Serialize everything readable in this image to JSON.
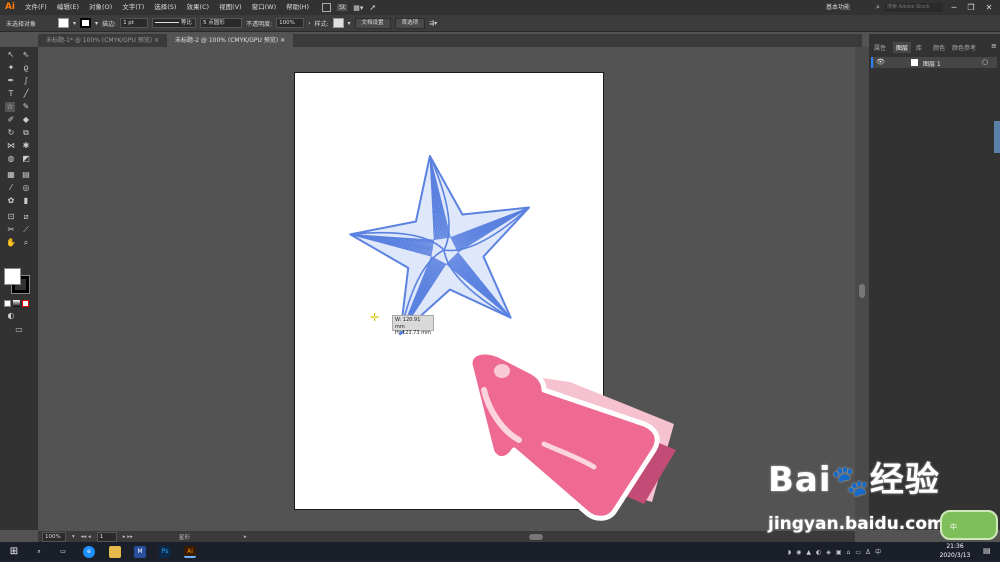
{
  "app": {
    "logo": "Ai"
  },
  "menubar": {
    "items": [
      "文件(F)",
      "编辑(E)",
      "对象(O)",
      "文字(T)",
      "选择(S)",
      "效果(C)",
      "视图(V)",
      "窗口(W)",
      "帮助(H)"
    ],
    "workspace": "基本功能",
    "search_placeholder": "搜索 Adobe Stock"
  },
  "control_bar": {
    "selection_label": "未选择对象",
    "stroke_label": "描边:",
    "stroke_value": "1 pt",
    "stroke_style": "等比",
    "brush_label": "5 点圆形",
    "opacity_label": "不透明度:",
    "opacity_value": "100%",
    "style_label": "样式:",
    "doc_setup_button": "文档设置",
    "preferences_button": "首选项"
  },
  "tabs": [
    {
      "label": "未标题-1* @ 100% (CMYK/GPU 预览)",
      "active": false
    },
    {
      "label": "未标题-2 @ 100% (CMYK/GPU 预览)",
      "active": true
    }
  ],
  "right_panel": {
    "tabs": [
      "属性",
      "图层",
      "库",
      "颜色",
      "颜色参考"
    ],
    "active_tab": "图层",
    "layer_name": "图层 1"
  },
  "canvas": {
    "measure_w": "W: 120.91 mm",
    "measure_h": "H: 123.73 mm",
    "star_color": "#5b82e0"
  },
  "statusbar": {
    "zoom": "100%",
    "page": "1",
    "tool_label": "星形"
  },
  "taskbar": {
    "time": "21:36",
    "date": "2020/3/13",
    "ime": "中"
  },
  "watermark": {
    "brand": "Bai",
    "brand_cn": "经验",
    "url": "jingyan.baidu.com"
  }
}
